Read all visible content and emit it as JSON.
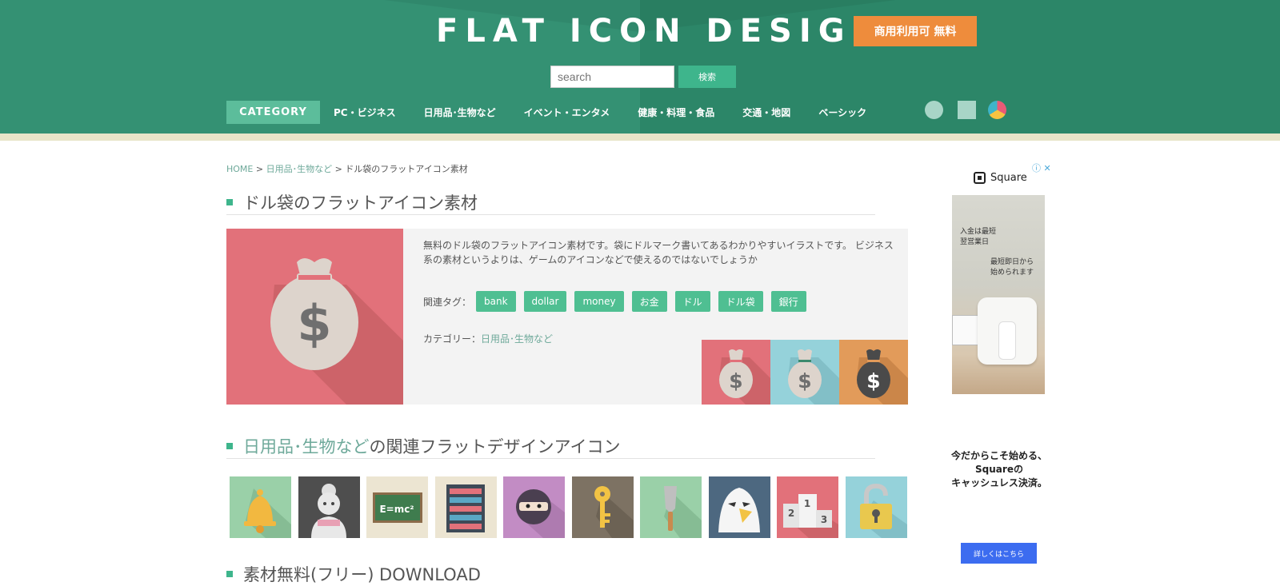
{
  "header": {
    "logo": "FLAT ICON DESIGN",
    "badge": "商用利用可 無料",
    "search_placeholder": "search",
    "search_button": "検索",
    "nav_category": "CATEGORY",
    "nav_items": [
      "PC・ビジネス",
      "日用品･生物など",
      "イベント・エンタメ",
      "健康・料理・食品",
      "交通・地図",
      "ベーシック"
    ],
    "color_swatches": [
      "circle-swatch",
      "square-swatch",
      "multicolor-swatch"
    ]
  },
  "breadcrumb": {
    "home": "HOME",
    "sep": ">",
    "category": "日用品･生物など",
    "current": "ドル袋のフラットアイコン素材"
  },
  "article": {
    "title": "ドル袋のフラットアイコン素材",
    "description": "無料のドル袋のフラットアイコン素材です。袋にドルマーク書いてあるわかりやすいイラストです。 ビジネス系の素材というよりは、ゲームのアイコンなどで使えるのではないでしょうか",
    "tags_label": "関連タグ：",
    "tags": [
      "bank",
      "dollar",
      "money",
      "お金",
      "ドル",
      "ドル袋",
      "銀行"
    ],
    "category_label": "カテゴリー：",
    "category_value": "日用品･生物など",
    "variants": [
      "pink",
      "light-blue",
      "orange"
    ]
  },
  "related": {
    "title_link": "日用品･生物など",
    "title_rest": "の関連フラットデザインアイコン",
    "icons": [
      "bell-icon",
      "grandma-icon",
      "blackboard-icon",
      "server-rack-icon",
      "ninja-icon",
      "key-icon",
      "trowel-icon",
      "eagle-icon",
      "podium-icon",
      "padlock-icon"
    ],
    "blackboard_text": "E=mc²"
  },
  "download": {
    "title": "素材無料(フリー) DOWNLOAD"
  },
  "ad": {
    "close": "ⓘ ✕",
    "brand": "Square",
    "note1_line1": "入金は最短",
    "note1_line2": "翌営業日",
    "note2_line1": "最短即日から",
    "note2_line2": "始められます",
    "copy_line1": "今だからこそ始める、",
    "copy_line2": "Squareの",
    "copy_line3": "キャッシュレス決済。",
    "button": "詳しくはこちら"
  },
  "colors": {
    "header_green": "#2f8a6e",
    "accent_green": "#3eb58c",
    "tag_green": "#4fbf92",
    "badge_orange": "#ee8c3c",
    "icon_pink": "#e2717a",
    "icon_blue": "#95d2da",
    "icon_orange": "#e29b5a",
    "ad_blue": "#3c6cf0"
  }
}
